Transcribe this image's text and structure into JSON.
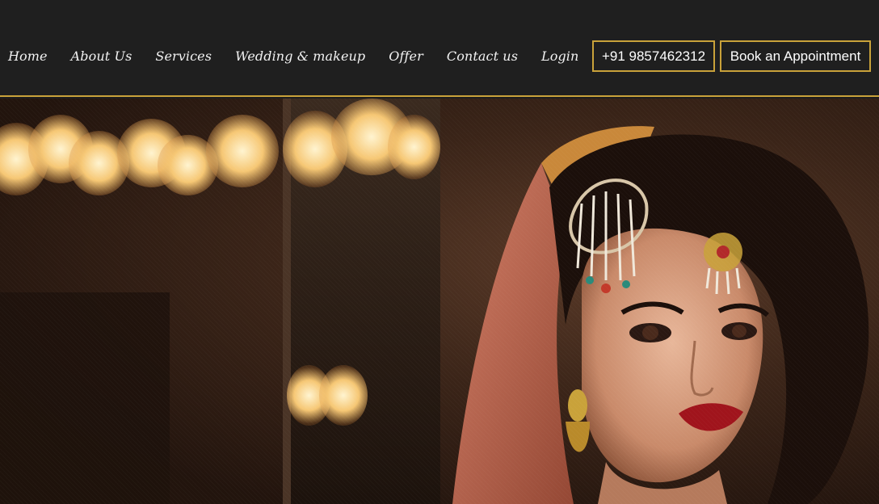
{
  "nav": {
    "links": [
      "Home",
      "About Us",
      "Services",
      "Wedding & makeup",
      "Offer",
      "Contact us",
      "Login"
    ]
  },
  "actions": {
    "phone": "+91 9857462312",
    "appointment": "Book an Appointment"
  },
  "colors": {
    "accent": "#c9a23a",
    "navbar_bg": "#1f1f1f",
    "text": "#f2f2f2"
  },
  "hero": {
    "image_alt": "bride-photo"
  }
}
